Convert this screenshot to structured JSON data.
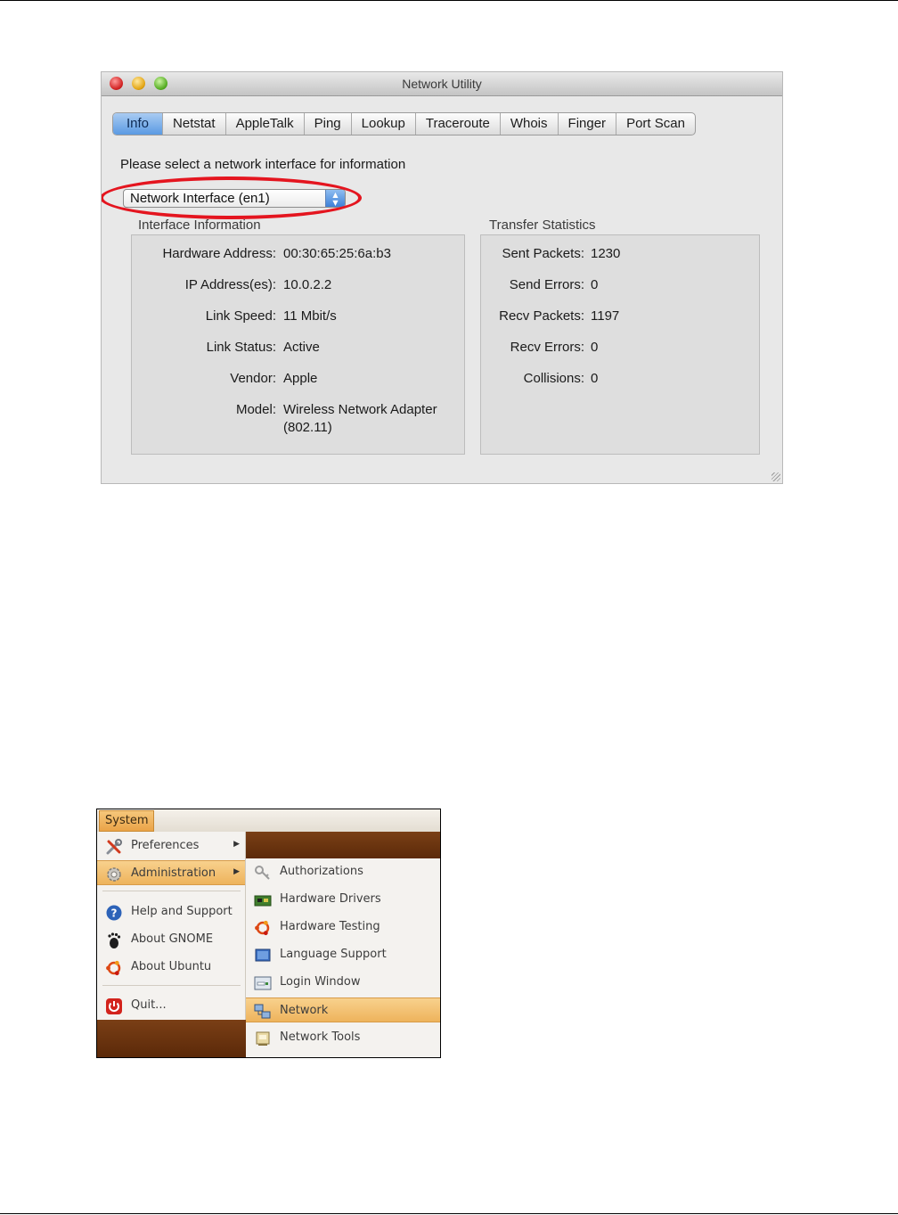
{
  "network_utility": {
    "title": "Network Utility",
    "tabs": [
      "Info",
      "Netstat",
      "AppleTalk",
      "Ping",
      "Lookup",
      "Traceroute",
      "Whois",
      "Finger",
      "Port Scan"
    ],
    "active_tab": "Info",
    "prompt": "Please select a network interface for information",
    "interface_select": "Network Interface (en1)",
    "interface_info": {
      "label": "Interface Information",
      "hardware_address_label": "Hardware Address:",
      "hardware_address": "00:30:65:25:6a:b3",
      "ip_label": "IP Address(es):",
      "ip": "10.0.2.2",
      "link_speed_label": "Link Speed:",
      "link_speed": "11 Mbit/s",
      "link_status_label": "Link Status:",
      "link_status": "Active",
      "vendor_label": "Vendor:",
      "vendor": "Apple",
      "model_label": "Model:",
      "model_line1": "Wireless Network Adapter",
      "model_line2": "(802.11)"
    },
    "transfer_stats": {
      "label": "Transfer Statistics",
      "sent_packets_label": "Sent Packets:",
      "sent_packets": "1230",
      "send_errors_label": "Send Errors:",
      "send_errors": "0",
      "recv_packets_label": "Recv Packets:",
      "recv_packets": "1197",
      "recv_errors_label": "Recv Errors:",
      "recv_errors": "0",
      "collisions_label": "Collisions:",
      "collisions": "0"
    },
    "highlight_color": "#e4151f"
  },
  "ubuntu_menu": {
    "top_menu": "System",
    "main_items": {
      "preferences": "Preferences",
      "administration": "Administration",
      "help": "Help and Support",
      "about_gnome": "About GNOME",
      "about_ubuntu": "About Ubuntu",
      "quit": "Quit..."
    },
    "admin_items": {
      "authorizations": "Authorizations",
      "hardware_drivers": "Hardware Drivers",
      "hardware_testing": "Hardware Testing",
      "language_support": "Language Support",
      "login_window": "Login Window",
      "network": "Network",
      "network_tools": "Network Tools"
    },
    "highlight_color": "#eeb35c"
  }
}
